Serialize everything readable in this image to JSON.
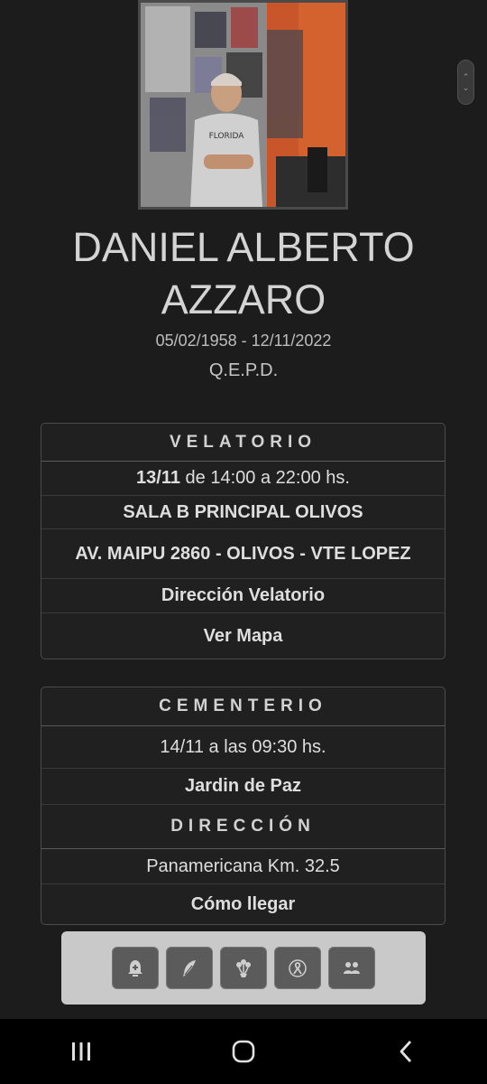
{
  "person": {
    "name_line1": "DANIEL ALBERTO",
    "name_line2": "AZZARO",
    "dates": "05/02/1958 - 12/11/2022",
    "rip": "Q.E.P.D."
  },
  "velatorio": {
    "title": "VELATORIO",
    "date_bold": "13/11",
    "time_text": " de 14:00 a 22:00 hs.",
    "room": "SALA B PRINCIPAL OLIVOS",
    "address": "AV. MAIPU 2860 - OLIVOS - VTE LOPEZ",
    "direction_label": "Dirección Velatorio",
    "map_link": "Ver Mapa"
  },
  "cementerio": {
    "title": "CEMENTERIO",
    "datetime": "14/11 a las 09:30 hs.",
    "place": "Jardin de Paz",
    "direction_title": "DIRECCIÓN",
    "address": "Panamericana Km. 32.5",
    "route_link": "Cómo llegar"
  },
  "toolbar": {
    "buttons": [
      "prayer-icon",
      "feather-icon",
      "flowers-icon",
      "ribbon-icon",
      "people-icon"
    ]
  },
  "colors": {
    "background": "#1c1c1c",
    "card_border": "#4b4b4b",
    "toolbar_bg": "#c9c9c9",
    "button_bg": "#5b5b5b"
  }
}
